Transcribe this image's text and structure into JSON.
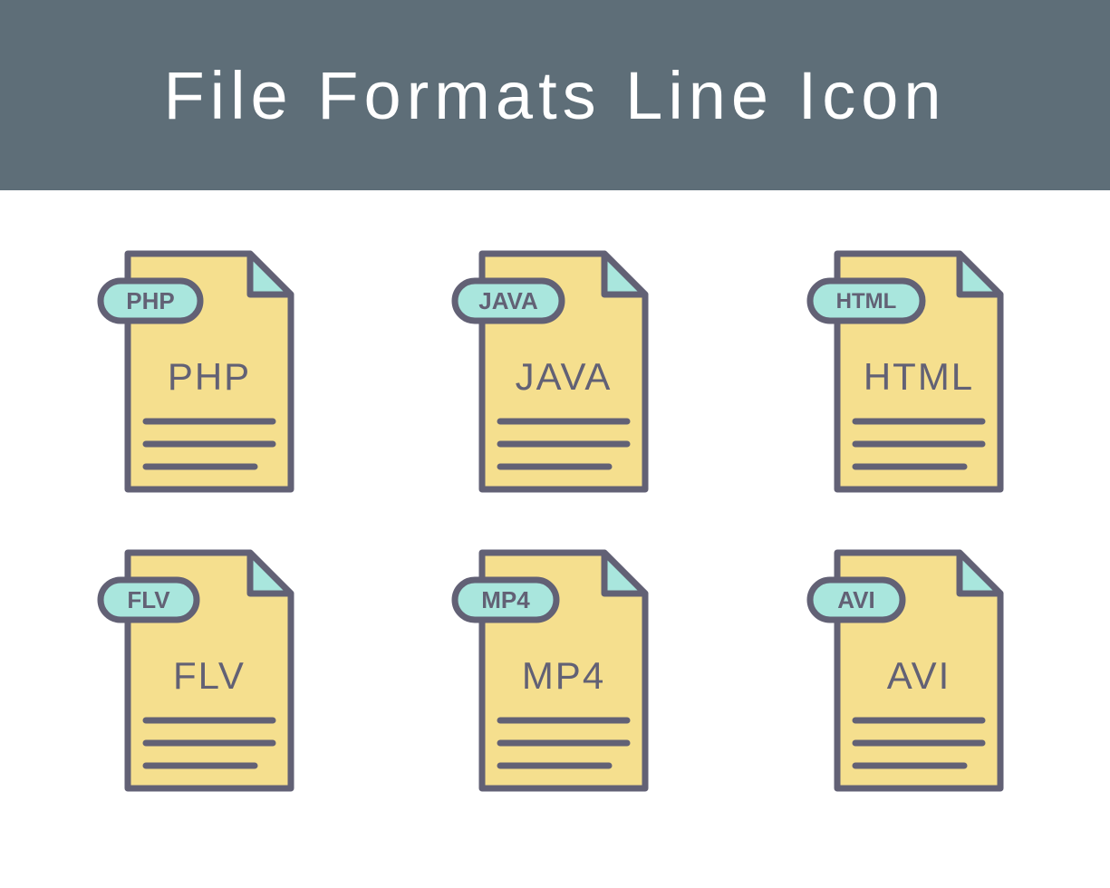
{
  "header": {
    "title": "File Formats Line Icon"
  },
  "colors": {
    "headerBg": "#5e6e78",
    "fileBody": "#f5df8e",
    "fileFold": "#a9e6dd",
    "badge": "#a9e6dd",
    "stroke": "#626175",
    "textDark": "#626175"
  },
  "icons": [
    {
      "badge": "PHP",
      "label": "PHP"
    },
    {
      "badge": "JAVA",
      "label": "JAVA"
    },
    {
      "badge": "HTML",
      "label": "HTML"
    },
    {
      "badge": "FLV",
      "label": "FLV"
    },
    {
      "badge": "MP4",
      "label": "MP4"
    },
    {
      "badge": "AVI",
      "label": "AVI"
    }
  ]
}
